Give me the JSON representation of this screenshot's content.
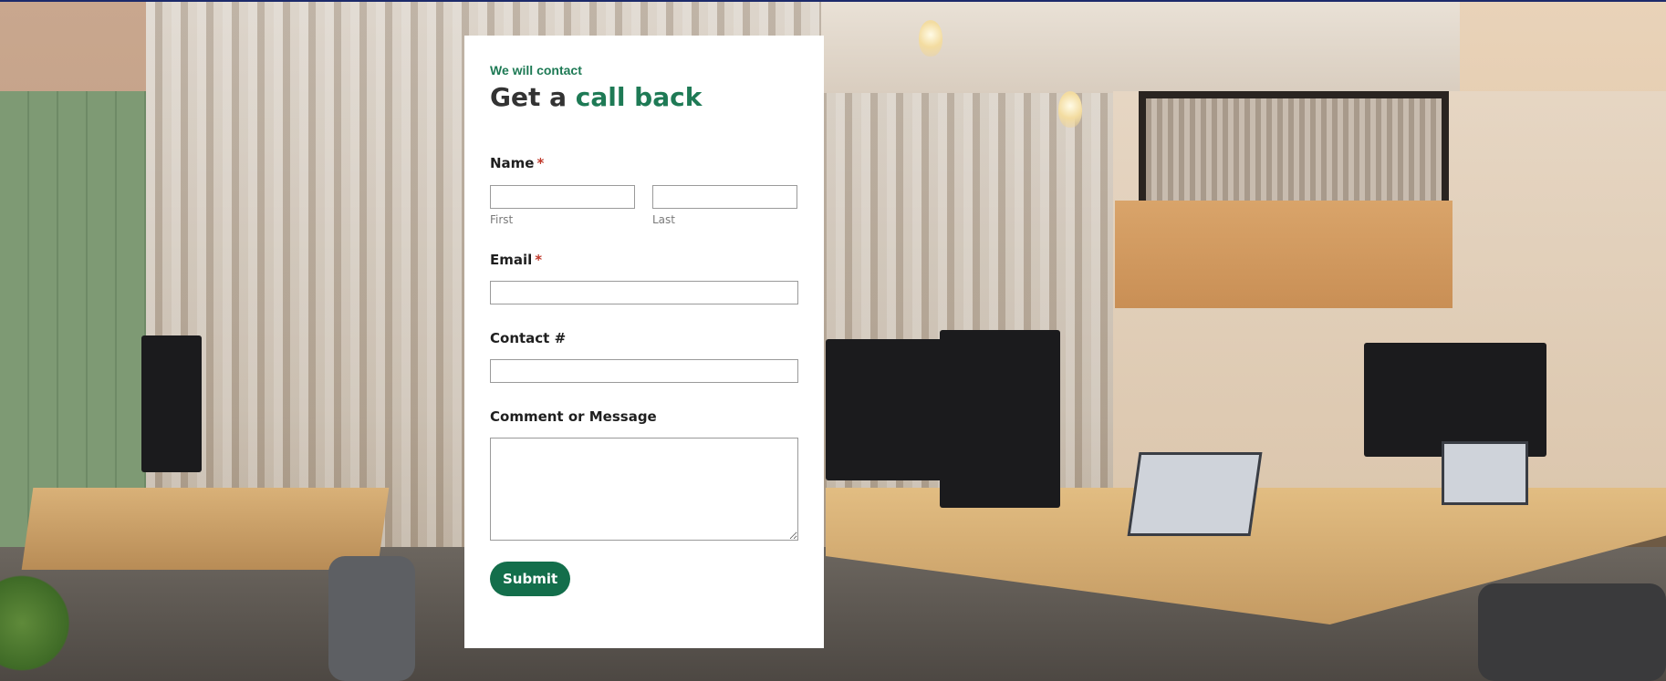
{
  "form": {
    "eyebrow": "We will contact",
    "heading_prefix": "Get a",
    "heading_accent": "call back",
    "fields": {
      "name": {
        "label": "Name",
        "required_mark": "*",
        "first": {
          "value": "",
          "sub_label": "First"
        },
        "last": {
          "value": "",
          "sub_label": "Last"
        }
      },
      "email": {
        "label": "Email",
        "required_mark": "*",
        "value": ""
      },
      "contact": {
        "label": "Contact #",
        "value": ""
      },
      "comment": {
        "label": "Comment or Message",
        "value": ""
      }
    },
    "submit_label": "Submit"
  },
  "colors": {
    "accent": "#1e7a55",
    "button": "#136e4b",
    "required": "#c0392b",
    "heading": "#333333"
  }
}
